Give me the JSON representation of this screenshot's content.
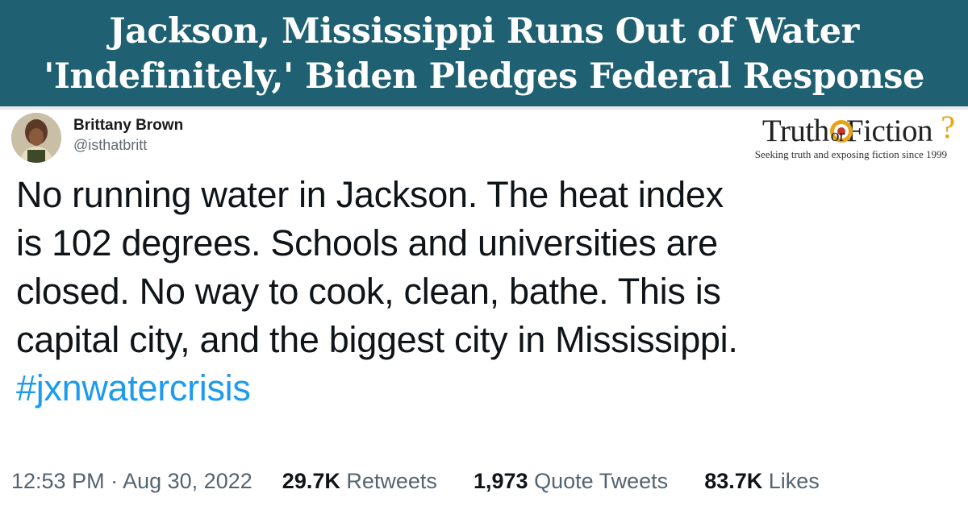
{
  "headline": {
    "line1": "Jackson, Mississippi Runs Out of Water",
    "line2": "'Indefinitely,' Biden Pledges Federal Response"
  },
  "tweet": {
    "author_name": "Brittany Brown",
    "author_handle": "@isthatbritt",
    "text_lines": [
      "No running water in Jackson. The heat index",
      "is 102 degrees. Schools and universities are",
      "closed. No way to cook, clean, bathe. This is",
      "capital city, and the biggest city in Mississippi."
    ],
    "hashtag": "#jxnwatercrisis",
    "time": "12:53 PM",
    "separator": "·",
    "date": "Aug 30, 2022",
    "retweets_count": "29.7K",
    "retweets_label": "Retweets",
    "quotes_count": "1,973",
    "quotes_label": "Quote Tweets",
    "likes_count": "83.7K",
    "likes_label": "Likes"
  },
  "logo": {
    "brand_left": "Truth",
    "brand_mid": "or",
    "brand_right": "Fiction",
    "brand_mark": "?",
    "tagline": "Seeking truth and exposing fiction since 1999"
  },
  "colors": {
    "banner": "#1f6072",
    "hashtag": "#1d9bf0",
    "logo_accent": "#e8a317"
  }
}
